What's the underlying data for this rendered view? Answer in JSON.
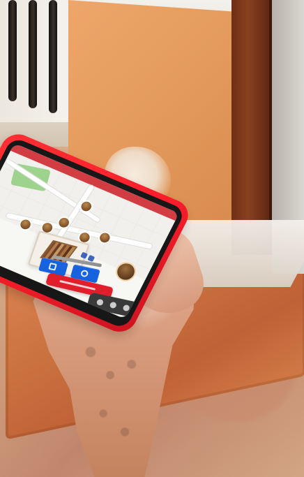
{
  "scene": {
    "description_text": "",
    "phone_color": "#ff2430",
    "screen_accent": "#1762df",
    "route_accent": "#e11e2b"
  }
}
